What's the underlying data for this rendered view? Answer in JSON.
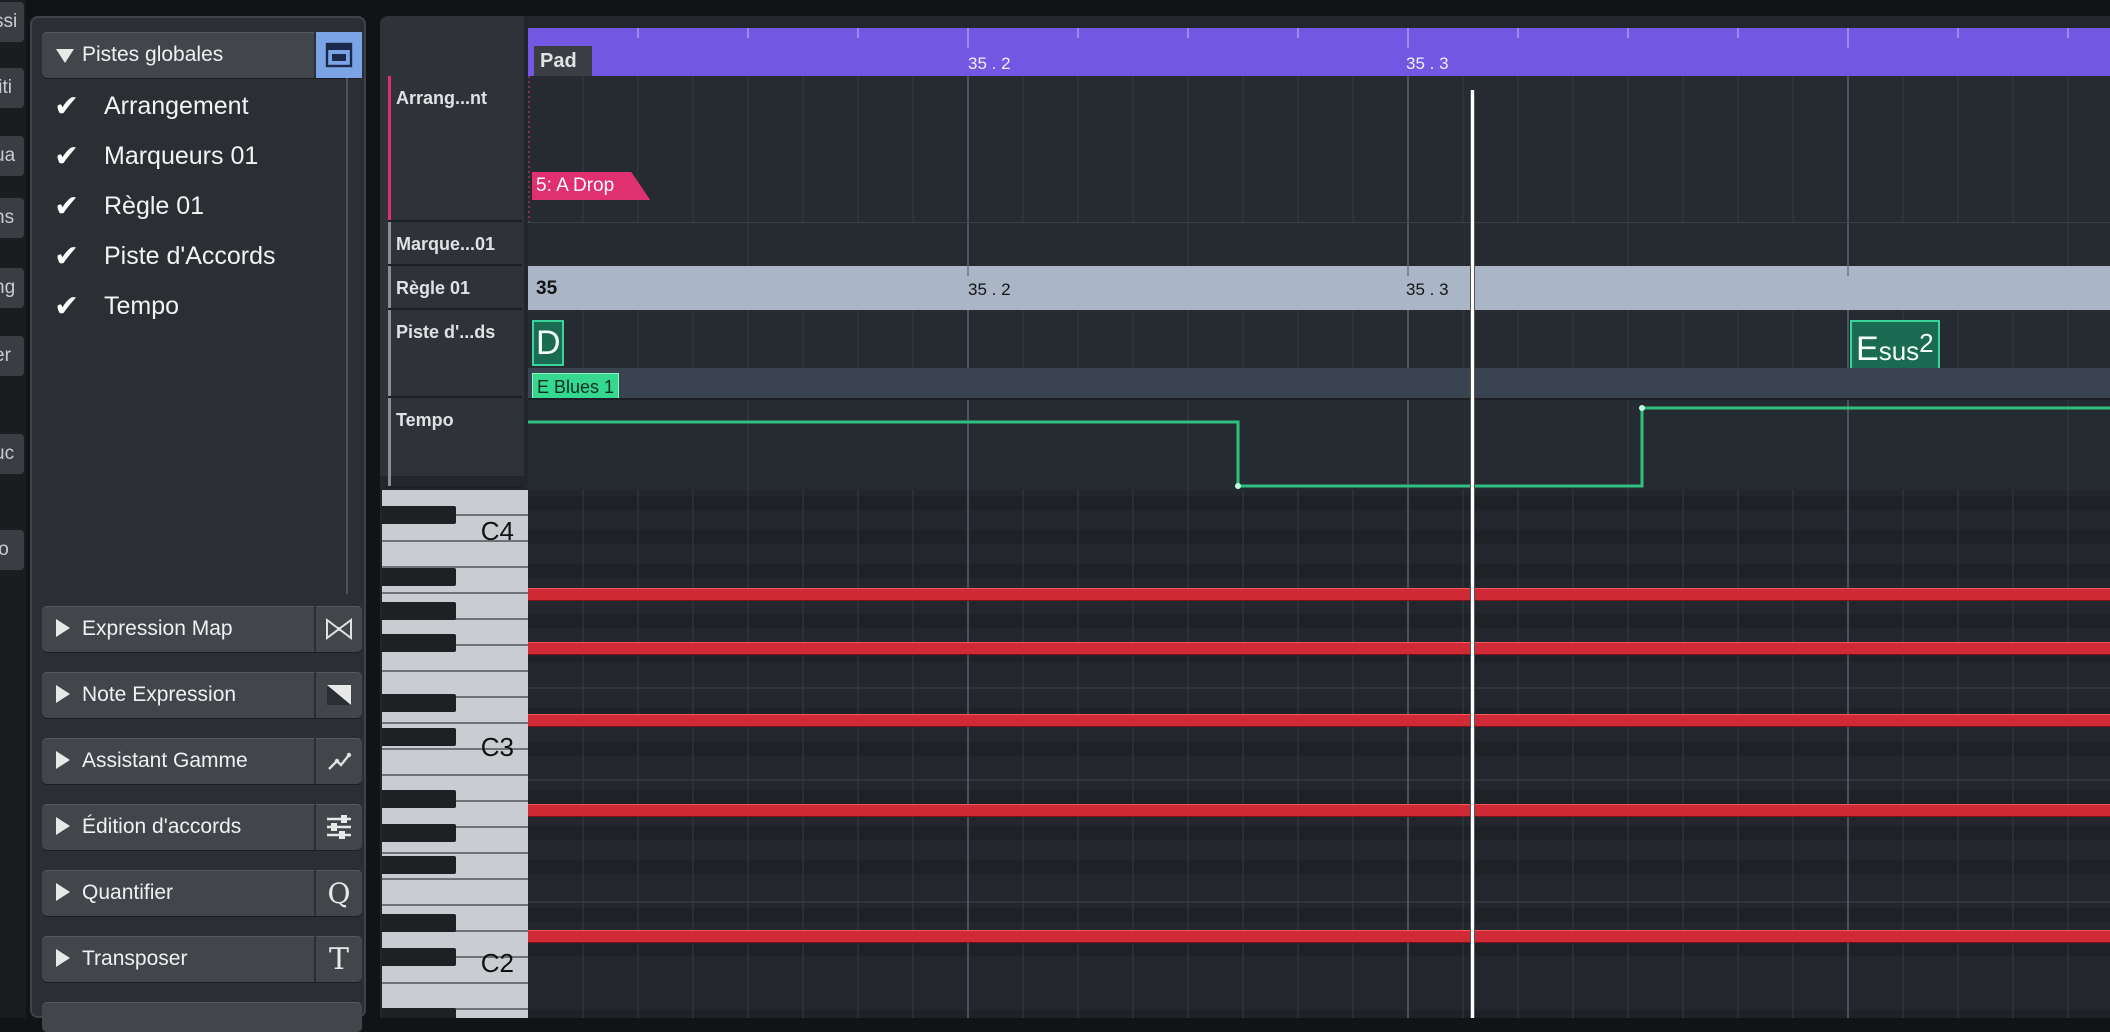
{
  "left_strip": [
    "ssi",
    "liti",
    "ua",
    "ns",
    "ng",
    "er",
    "uc",
    "lo"
  ],
  "inspector": {
    "global_header": "Pistes globales",
    "tracks": [
      "Arrangement",
      "Marqueurs 01",
      "Règle 01",
      "Piste d'Accords",
      "Tempo"
    ],
    "sections": [
      {
        "label": "Expression Map",
        "icon": "expression-map-icon"
      },
      {
        "label": "Note Expression",
        "icon": "note-expression-icon"
      },
      {
        "label": "Assistant Gamme",
        "icon": "scale-assistant-icon"
      },
      {
        "label": "Édition d'accords",
        "icon": "chord-editing-icon"
      },
      {
        "label": "Quantifier",
        "icon": "quantize-icon",
        "glyph": "Q"
      },
      {
        "label": "Transposer",
        "icon": "transpose-icon",
        "glyph": "T"
      }
    ]
  },
  "editor": {
    "track_headers": [
      "Arrang...nt",
      "Marque...01",
      "Règle 01",
      "Piste d'...ds",
      "Tempo"
    ],
    "part_name": "Pad",
    "ruler_top": {
      "bar": "",
      "marks": [
        "35 . 2",
        "35 . 3"
      ]
    },
    "ruler_lane": {
      "bar": "35",
      "marks": [
        "35 . 2",
        "35 . 3"
      ]
    },
    "arrangement_event": "5: A Drop",
    "chords": [
      {
        "root": "D",
        "suffix": ""
      },
      {
        "root": "E",
        "suffix": "sus",
        "sup": "2"
      }
    ],
    "scale_event": "E Blues 1",
    "keys": [
      "C4",
      "C3",
      "C2"
    ]
  },
  "colors": {
    "part_ruler": "#7157e2",
    "arrangement_event": "#e1306f",
    "chord": "#39d39b",
    "note": "#cf2a36",
    "tempo_line": "#2fbf7f"
  }
}
